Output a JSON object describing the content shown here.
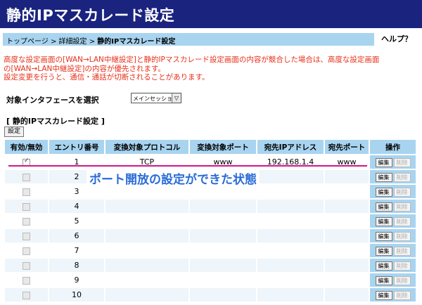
{
  "header": {
    "title": "静的IPマスカレード設定"
  },
  "breadcrumb": {
    "prefix": "トップページ > 詳細設定 > ",
    "current": "静的IPマスカレード設定",
    "help": "ヘルプ？"
  },
  "warning": {
    "line1": "高度な設定画面の[WAN→LAN中継設定]と静的IPマスカレード設定画面の内容が競合した場合は、高度な設定画面",
    "line2": "の[WAN→LAN中継設定]の内容が優先されます。",
    "line3": "設定変更を行うと、通信・通話が切断されることがあります。"
  },
  "interface": {
    "label": "対象インタフェースを選択",
    "selected": "メインセッション",
    "arrow": "▽"
  },
  "section_title": "[ 静的IPマスカレード設定 ]",
  "set_button": "設定",
  "columns": [
    "有効/無効",
    "エントリ番号",
    "変換対象プロトコル",
    "変換対象ポート",
    "宛先IPアドレス",
    "宛先ポート",
    "操作"
  ],
  "rows": [
    {
      "no": "1",
      "enabled": true,
      "protocol": "TCP",
      "port": "www",
      "ip": "192.168.1.4",
      "dport": "www"
    },
    {
      "no": "2",
      "enabled": false,
      "protocol": "",
      "port": "",
      "ip": "",
      "dport": ""
    },
    {
      "no": "3",
      "enabled": false,
      "protocol": "",
      "port": "",
      "ip": "",
      "dport": ""
    },
    {
      "no": "4",
      "enabled": false,
      "protocol": "",
      "port": "",
      "ip": "",
      "dport": ""
    },
    {
      "no": "5",
      "enabled": false,
      "protocol": "",
      "port": "",
      "ip": "",
      "dport": ""
    },
    {
      "no": "6",
      "enabled": false,
      "protocol": "",
      "port": "",
      "ip": "",
      "dport": ""
    },
    {
      "no": "7",
      "enabled": false,
      "protocol": "",
      "port": "",
      "ip": "",
      "dport": ""
    },
    {
      "no": "8",
      "enabled": false,
      "protocol": "",
      "port": "",
      "ip": "",
      "dport": ""
    },
    {
      "no": "9",
      "enabled": false,
      "protocol": "",
      "port": "",
      "ip": "",
      "dport": ""
    },
    {
      "no": "10",
      "enabled": false,
      "protocol": "",
      "port": "",
      "ip": "",
      "dport": ""
    }
  ],
  "edit_label": "編集",
  "delete_label": "削除",
  "annotation": "ポート開放の設定ができた状態",
  "colors": {
    "title_bg": "#1a237e",
    "header_bg": "#a8d4f0",
    "warning": "#e8301a",
    "annotation": "#2a6cd8",
    "highlight": "#d0168f"
  }
}
